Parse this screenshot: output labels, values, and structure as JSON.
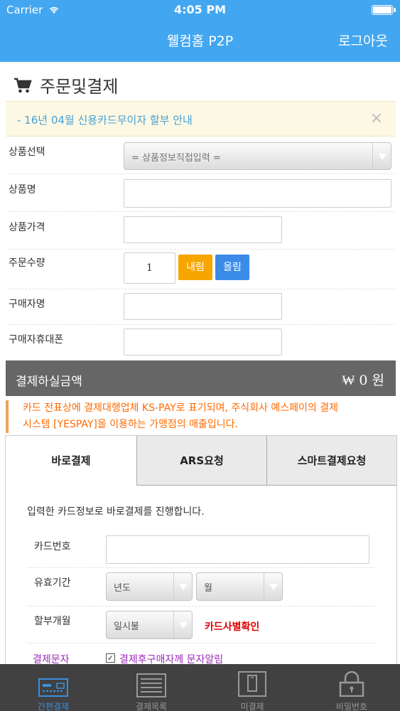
{
  "status_bar": {
    "carrier": "Carrier",
    "time": "4:05 PM"
  },
  "nav": {
    "title": "웰컴홈 P2P",
    "logout": "로그아웃"
  },
  "section": {
    "title": "주문및결제"
  },
  "notice": {
    "text": "- 16년 04월 신용카드무이자 할부 안내",
    "close": "×"
  },
  "form": {
    "product_select": {
      "label": "상품선택",
      "value": "= 상품정보직접입력 ="
    },
    "product_name": {
      "label": "상품명",
      "value": ""
    },
    "product_price": {
      "label": "상품가격",
      "value": ""
    },
    "quantity": {
      "label": "주문수량",
      "value": "1",
      "down": "내림",
      "up": "올림"
    },
    "buyer_name": {
      "label": "구매자명",
      "value": ""
    },
    "buyer_phone": {
      "label": "구매자휴대폰",
      "value": ""
    }
  },
  "amount": {
    "label": "결제하실금액",
    "value": "₩ 0 원"
  },
  "ks_notice": {
    "line1": "카드 전표상에 결제대행업체 KS-PAY로 표기되며, 주식회사 예스페이의 결제",
    "line2": "시스템 [YESPAY]을 이용하는 가맹점의 매출입니다."
  },
  "payment_tabs": [
    {
      "label": "바로결제",
      "active": true
    },
    {
      "label": "ARS요청",
      "active": false
    },
    {
      "label": "스마트결제요청",
      "active": false
    }
  ],
  "direct_pay": {
    "description": "입력한 카드정보로 바로결제를 진행합니다.",
    "card_number": {
      "label": "카드번호",
      "value": ""
    },
    "expiry": {
      "label": "유효기간",
      "year": "년도",
      "month": "월"
    },
    "installment": {
      "label": "할부개월",
      "value": "일시불",
      "card_check": "카드사별확인"
    },
    "sms": {
      "label": "결제문자",
      "checked": true,
      "text": "결제후구매자께 문자알림"
    }
  },
  "tab_bar": [
    {
      "label": "간편결제",
      "icon": "card-terminal-icon",
      "active": true
    },
    {
      "label": "결제목록",
      "icon": "list-icon",
      "active": false
    },
    {
      "label": "미결제",
      "icon": "phone-icon",
      "active": false
    },
    {
      "label": "비밀번호",
      "icon": "lock-icon",
      "active": false
    }
  ],
  "colors": {
    "nav_blue": "#42a6f0",
    "down_orange": "#f7a600",
    "up_blue": "#3a8ce8",
    "tab_active": "#3a8fe0"
  }
}
